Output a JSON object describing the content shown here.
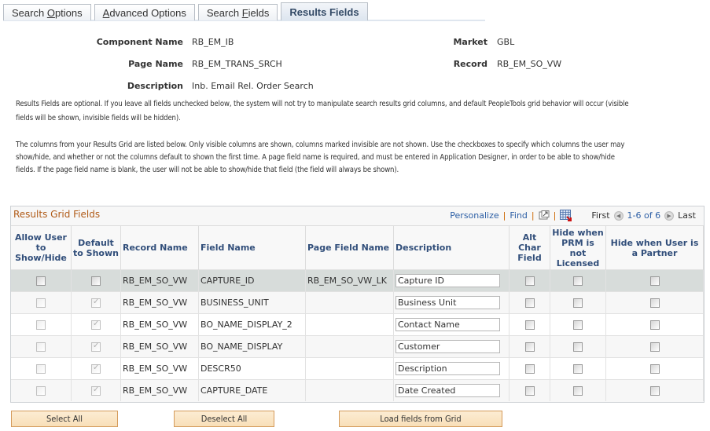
{
  "tabs": [
    {
      "label_pre": "Search ",
      "label_u": "O",
      "label_post": "ptions",
      "active": false
    },
    {
      "label_pre": "",
      "label_u": "A",
      "label_post": "dvanced Options",
      "active": false
    },
    {
      "label_pre": "Search ",
      "label_u": "F",
      "label_post": "ields",
      "active": false
    },
    {
      "label": "Results Fields",
      "active": true
    }
  ],
  "header": {
    "component_name_label": "Component Name",
    "component_name": "RB_EM_IB",
    "page_name_label": "Page Name",
    "page_name": "RB_EM_TRANS_SRCH",
    "description_label": "Description",
    "description": "Inb. Email Rel. Order Search",
    "market_label": "Market",
    "market": "GBL",
    "record_label": "Record",
    "record": "RB_EM_SO_VW"
  },
  "info": {
    "para1": "Results Fields are optional. If you leave all fields unchecked below, the system will not try to manipulate search results grid columns, and default PeopleTools grid behavior will occur (visible fields will be shown, invisible fields will be hidden).",
    "para2": "The columns from your Results Grid are listed below. Only visible columns are shown, columns marked invisible are not shown. Use the checkboxes to specify which columns the user may show/hide, and whether or not the columns default to shown the first time. A page field name is required, and must be entered in Application Designer, in order to be able to show/hide fields. If the page field name is blank, the user will not be able to show/hide that field (the field will always be shown)."
  },
  "grid": {
    "title": "Results Grid Fields",
    "personalize": "Personalize",
    "find": "Find",
    "separator": "|",
    "first": "First",
    "range": "1-6 of 6",
    "last": "Last",
    "columns": {
      "allow": "Allow User to Show/Hide",
      "default": "Default to Shown",
      "record": "Record Name",
      "field": "Field Name",
      "page_field": "Page Field Name",
      "description": "Description",
      "alt_char": "Alt Char Field",
      "hide_prm": "Hide when PRM is not Licensed",
      "hide_partner": "Hide when User is a Partner"
    },
    "rows": [
      {
        "allow": false,
        "allow_enabled": true,
        "default": false,
        "default_enabled": true,
        "record": "RB_EM_SO_VW",
        "field": "CAPTURE_ID",
        "page_field": "RB_EM_SO_VW_LK",
        "description": "Capture ID",
        "alt_char": false,
        "hide_prm": false,
        "hide_partner": false
      },
      {
        "allow": false,
        "allow_enabled": false,
        "default": true,
        "default_enabled": false,
        "record": "RB_EM_SO_VW",
        "field": "BUSINESS_UNIT",
        "page_field": "",
        "description": "Business Unit",
        "alt_char": false,
        "hide_prm": false,
        "hide_partner": false
      },
      {
        "allow": false,
        "allow_enabled": false,
        "default": true,
        "default_enabled": false,
        "record": "RB_EM_SO_VW",
        "field": "BO_NAME_DISPLAY_2",
        "page_field": "",
        "description": "Contact Name",
        "alt_char": false,
        "hide_prm": false,
        "hide_partner": false
      },
      {
        "allow": false,
        "allow_enabled": false,
        "default": true,
        "default_enabled": false,
        "record": "RB_EM_SO_VW",
        "field": "BO_NAME_DISPLAY",
        "page_field": "",
        "description": "Customer",
        "alt_char": false,
        "hide_prm": false,
        "hide_partner": false
      },
      {
        "allow": false,
        "allow_enabled": false,
        "default": true,
        "default_enabled": false,
        "record": "RB_EM_SO_VW",
        "field": "DESCR50",
        "page_field": "",
        "description": "Description",
        "alt_char": false,
        "hide_prm": false,
        "hide_partner": false
      },
      {
        "allow": false,
        "allow_enabled": false,
        "default": true,
        "default_enabled": false,
        "record": "RB_EM_SO_VW",
        "field": "CAPTURE_DATE",
        "page_field": "",
        "description": "Date Created",
        "alt_char": false,
        "hide_prm": false,
        "hide_partner": false
      }
    ]
  },
  "buttons": {
    "select_all": "Select All",
    "deselect_all": "Deselect All",
    "load_fields": "Load fields from Grid"
  },
  "colors": {
    "grid_title": "#b05b18",
    "header_text": "#314e7a",
    "link": "#2e60a6",
    "selected_row": "#d7dcda",
    "button_bg": "#fbe6c6",
    "button_border": "#d49a5a"
  }
}
